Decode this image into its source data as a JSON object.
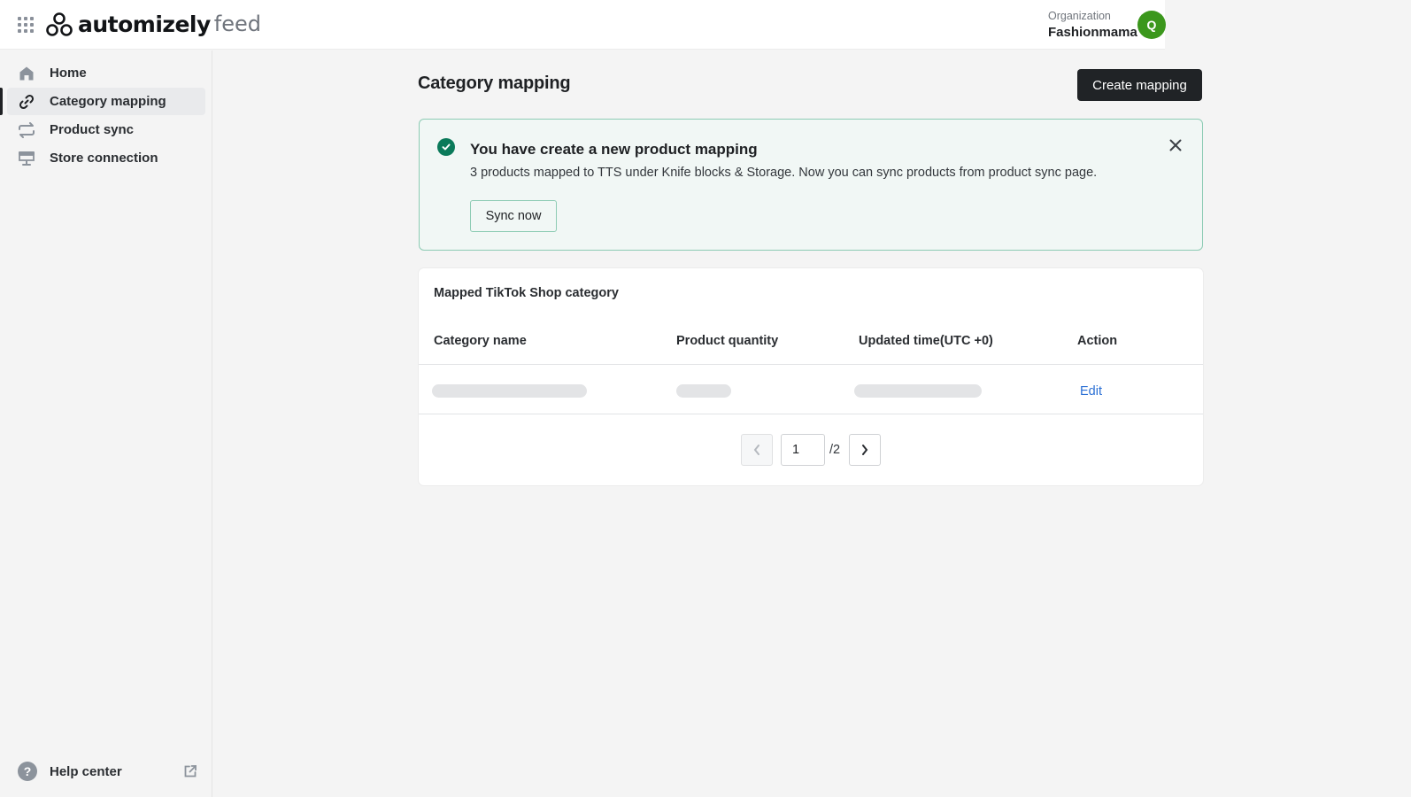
{
  "header": {
    "brand": "automizely",
    "product": "feed",
    "org_label": "Organization",
    "org_name": "Fashionmama",
    "avatar_initial": "Q",
    "avatar_color": "#3b971c"
  },
  "sidebar": {
    "items": [
      {
        "label": "Home",
        "icon": "home-icon",
        "active": false
      },
      {
        "label": "Category mapping",
        "icon": "link-icon",
        "active": true
      },
      {
        "label": "Product sync",
        "icon": "sync-icon",
        "active": false
      },
      {
        "label": "Store connection",
        "icon": "store-icon",
        "active": false
      }
    ],
    "help": {
      "label": "Help center",
      "icon": "help-icon",
      "external_icon": "external-link-icon"
    }
  },
  "main": {
    "title": "Category mapping",
    "create_button": "Create mapping",
    "banner": {
      "title": "You have create a new product mapping",
      "text": "3 products mapped to TTS under Knife blocks & Storage. Now you can sync products from product sync page.",
      "button": "Sync now",
      "accent": "#0b7a5a"
    },
    "table": {
      "title": "Mapped TikTok Shop category",
      "columns": [
        "Category name",
        "Product quantity",
        "Updated time(UTC +0)",
        "Action"
      ],
      "rows": [
        {
          "category_name": "",
          "product_quantity": "",
          "updated_time": "",
          "action": "Edit",
          "loading": true
        }
      ]
    },
    "pagination": {
      "current": "1",
      "total_label": "/2"
    }
  }
}
